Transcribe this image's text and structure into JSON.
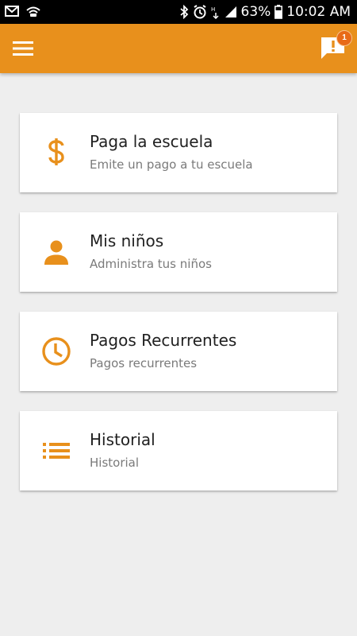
{
  "status_bar": {
    "battery": "63%",
    "time": "10:02 AM"
  },
  "app_bar": {
    "notification_count": "1",
    "accent_color": "#e8901c",
    "badge_color": "#e86a17"
  },
  "menu": {
    "items": [
      {
        "title": "Paga la escuela",
        "subtitle": "Emite un pago a tu escuela",
        "icon": "dollar-icon"
      },
      {
        "title": "Mis niños",
        "subtitle": "Administra tus niños",
        "icon": "person-icon"
      },
      {
        "title": "Pagos Recurrentes",
        "subtitle": "Pagos recurrentes",
        "icon": "clock-icon"
      },
      {
        "title": "Historial",
        "subtitle": "Historial",
        "icon": "list-icon"
      }
    ]
  }
}
